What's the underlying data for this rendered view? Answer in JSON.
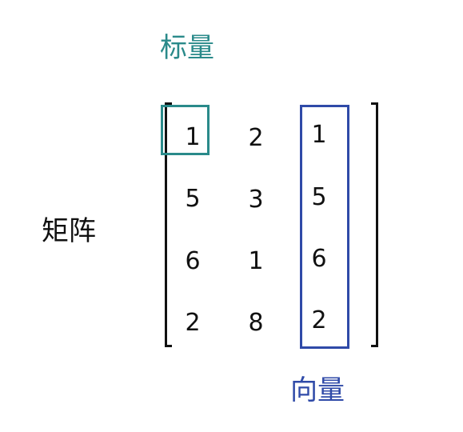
{
  "labels": {
    "scalar": "标量",
    "matrix": "矩阵",
    "vector": "向量"
  },
  "matrix": {
    "rows": [
      [
        "1",
        "2",
        "1"
      ],
      [
        "5",
        "3",
        "5"
      ],
      [
        "6",
        "1",
        "6"
      ],
      [
        "2",
        "8",
        "2"
      ]
    ]
  },
  "colors": {
    "scalar": "#2a8a8a",
    "vector": "#2f4aa8",
    "text": "#111111"
  }
}
